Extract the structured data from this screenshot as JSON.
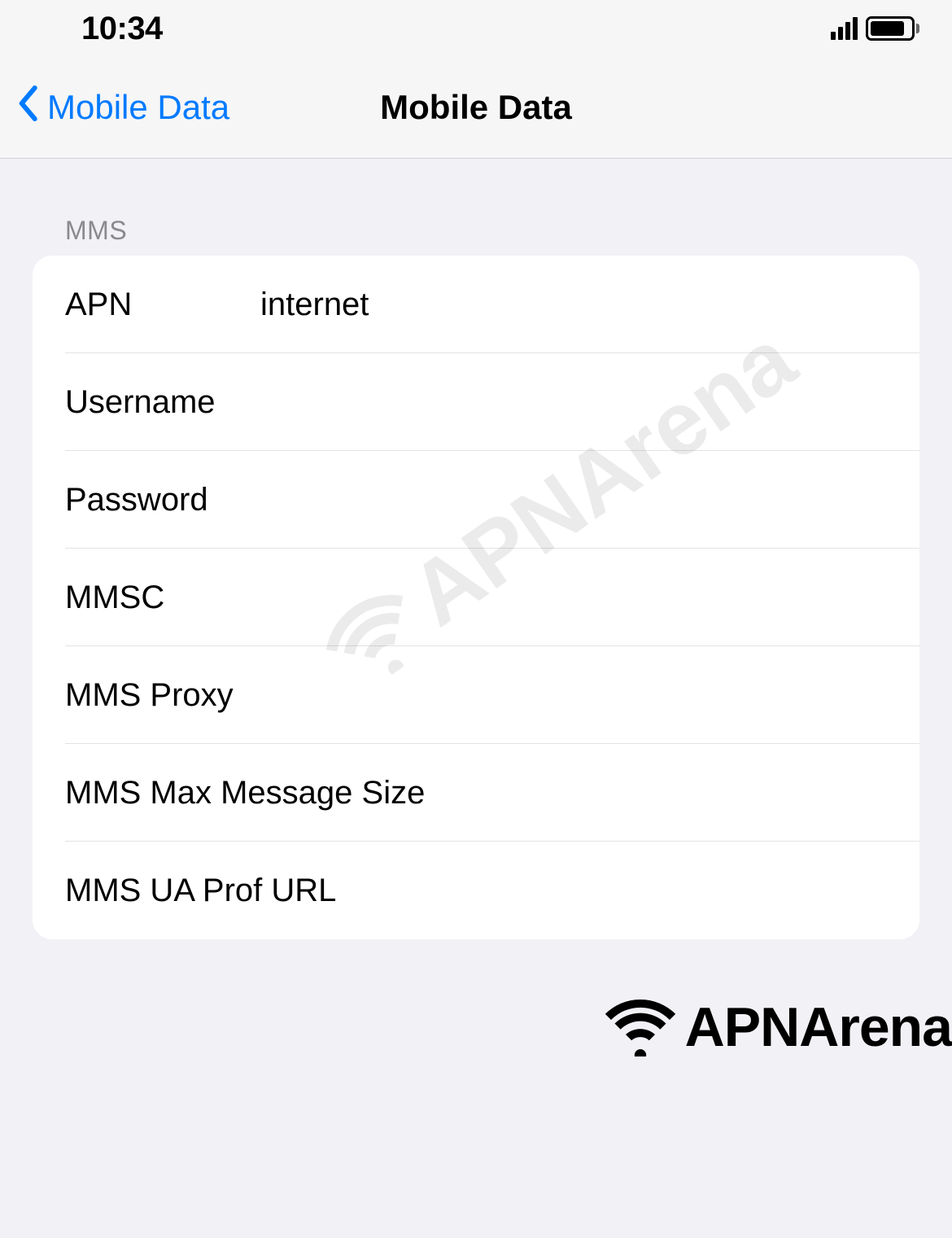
{
  "statusBar": {
    "time": "10:34"
  },
  "nav": {
    "backLabel": "Mobile Data",
    "title": "Mobile Data"
  },
  "section": {
    "header": "MMS"
  },
  "fields": {
    "apn": {
      "label": "APN",
      "value": "internet"
    },
    "username": {
      "label": "Username",
      "value": ""
    },
    "password": {
      "label": "Password",
      "value": ""
    },
    "mmsc": {
      "label": "MMSC",
      "value": ""
    },
    "mmsProxy": {
      "label": "MMS Proxy",
      "value": ""
    },
    "mmsMaxSize": {
      "label": "MMS Max Message Size",
      "value": ""
    },
    "mmsUaProf": {
      "label": "MMS UA Prof URL",
      "value": ""
    }
  },
  "watermark": {
    "text": "APNArena"
  }
}
